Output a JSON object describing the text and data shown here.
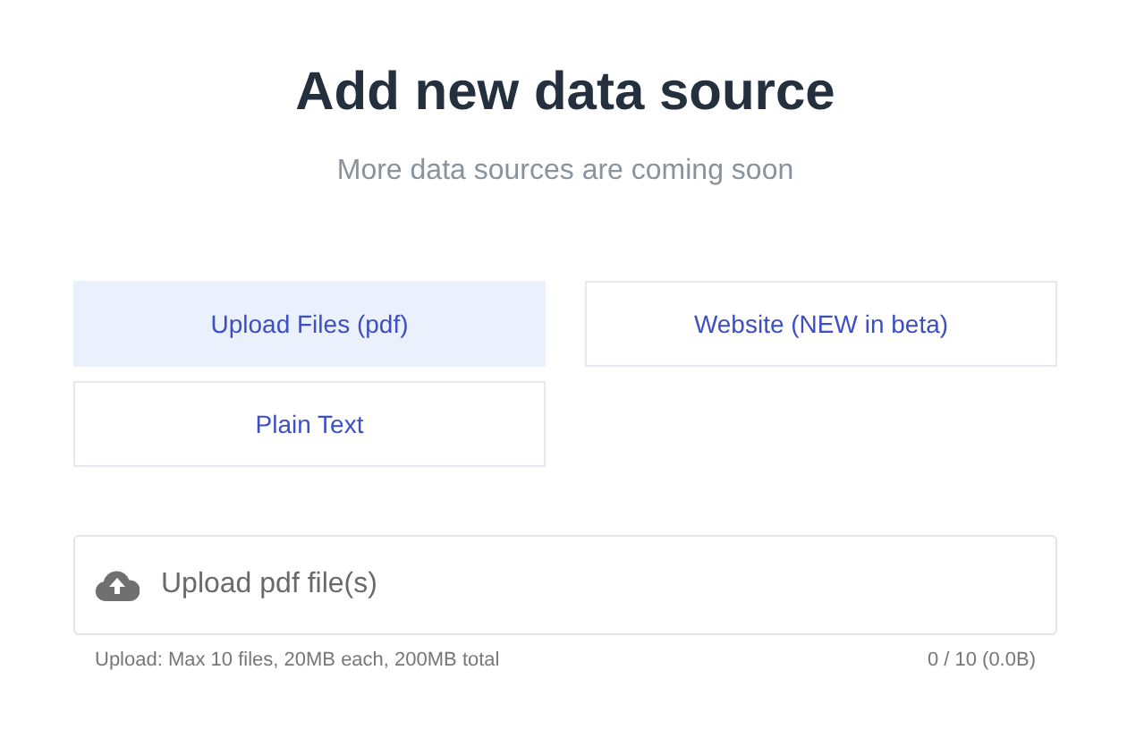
{
  "header": {
    "title": "Add new data source",
    "subtitle": "More data sources are coming soon"
  },
  "source_tabs": [
    {
      "label": "Upload Files (pdf)",
      "selected": true
    },
    {
      "label": "Website (NEW in beta)",
      "selected": false
    },
    {
      "label": "Plain Text",
      "selected": false
    }
  ],
  "upload": {
    "placeholder": "Upload pdf file(s)",
    "limits": "Upload: Max 10 files, 20MB each, 200MB total",
    "count": "0 / 10 (0.0B)"
  }
}
